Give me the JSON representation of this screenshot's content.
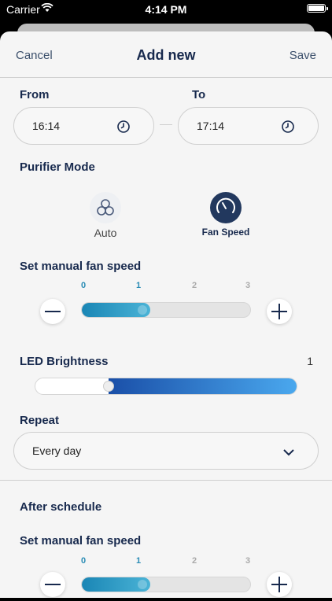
{
  "status_bar": {
    "carrier": "Carrier",
    "time": "4:14 PM"
  },
  "nav": {
    "cancel": "Cancel",
    "title": "Add new",
    "save": "Save"
  },
  "schedule": {
    "from_label": "From",
    "to_label": "To",
    "from_value": "16:14",
    "to_value": "17:14"
  },
  "purifier_mode": {
    "label": "Purifier Mode",
    "options": [
      {
        "label": "Auto",
        "icon": "fan-icon",
        "selected": false
      },
      {
        "label": "Fan Speed",
        "icon": "speedometer-icon",
        "selected": true
      }
    ]
  },
  "manual_fan": {
    "label": "Set manual fan speed",
    "ticks": [
      "0",
      "1",
      "2",
      "3"
    ],
    "value": 1,
    "max": 3
  },
  "led": {
    "label": "LED Brightness",
    "value_text": "1",
    "level": 0.28
  },
  "repeat": {
    "label": "Repeat",
    "value": "Every day"
  },
  "after_schedule": {
    "label": "After schedule",
    "fan_label": "Set manual fan speed",
    "ticks": [
      "0",
      "1",
      "2",
      "3"
    ],
    "value": 1,
    "max": 3
  },
  "colors": {
    "accent": "#1a86b5",
    "navy": "#17294d",
    "led_gradient_end": "#4aa8ee"
  }
}
